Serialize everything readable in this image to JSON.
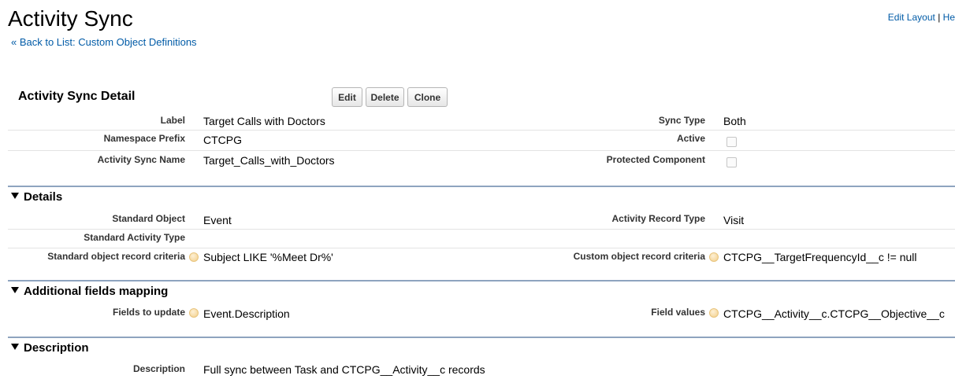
{
  "page": {
    "title": "Activity Sync",
    "back_link": "« Back to List: Custom Object Definitions",
    "edit_layout": "Edit Layout",
    "separator": "|",
    "help_link": "He"
  },
  "detail": {
    "title": "Activity Sync Detail",
    "buttons": {
      "edit": "Edit",
      "delete": "Delete",
      "clone": "Clone"
    },
    "fields": {
      "label": {
        "label": "Label",
        "value": "Target Calls with Doctors"
      },
      "namespace": {
        "label": "Namespace Prefix",
        "value": "CTCPG"
      },
      "sync_name": {
        "label": "Activity Sync Name",
        "value": "Target_Calls_with_Doctors"
      },
      "sync_type": {
        "label": "Sync Type",
        "value": "Both"
      },
      "active": {
        "label": "Active",
        "checked": false
      },
      "protected": {
        "label": "Protected Component",
        "checked": false
      }
    }
  },
  "sections": {
    "details": {
      "title": "Details",
      "standard_object": {
        "label": "Standard Object",
        "value": "Event"
      },
      "activity_record_type": {
        "label": "Activity Record Type",
        "value": "Visit"
      },
      "standard_activity_type": {
        "label": "Standard Activity Type",
        "value": ""
      },
      "std_criteria": {
        "label": "Standard object record criteria",
        "value": "Subject LIKE '%Meet Dr%'"
      },
      "custom_criteria": {
        "label": "Custom object record criteria",
        "value": "CTCPG__TargetFrequencyId__c != null"
      }
    },
    "mapping": {
      "title": "Additional fields mapping",
      "fields_to_update": {
        "label": "Fields to update",
        "value": "Event.Description"
      },
      "field_values": {
        "label": "Field values",
        "value": "CTCPG__Activity__c.CTCPG__Objective__c"
      }
    },
    "description": {
      "title": "Description",
      "description": {
        "label": "Description",
        "value": "Full sync between Task and CTCPG__Activity__c records"
      }
    }
  }
}
